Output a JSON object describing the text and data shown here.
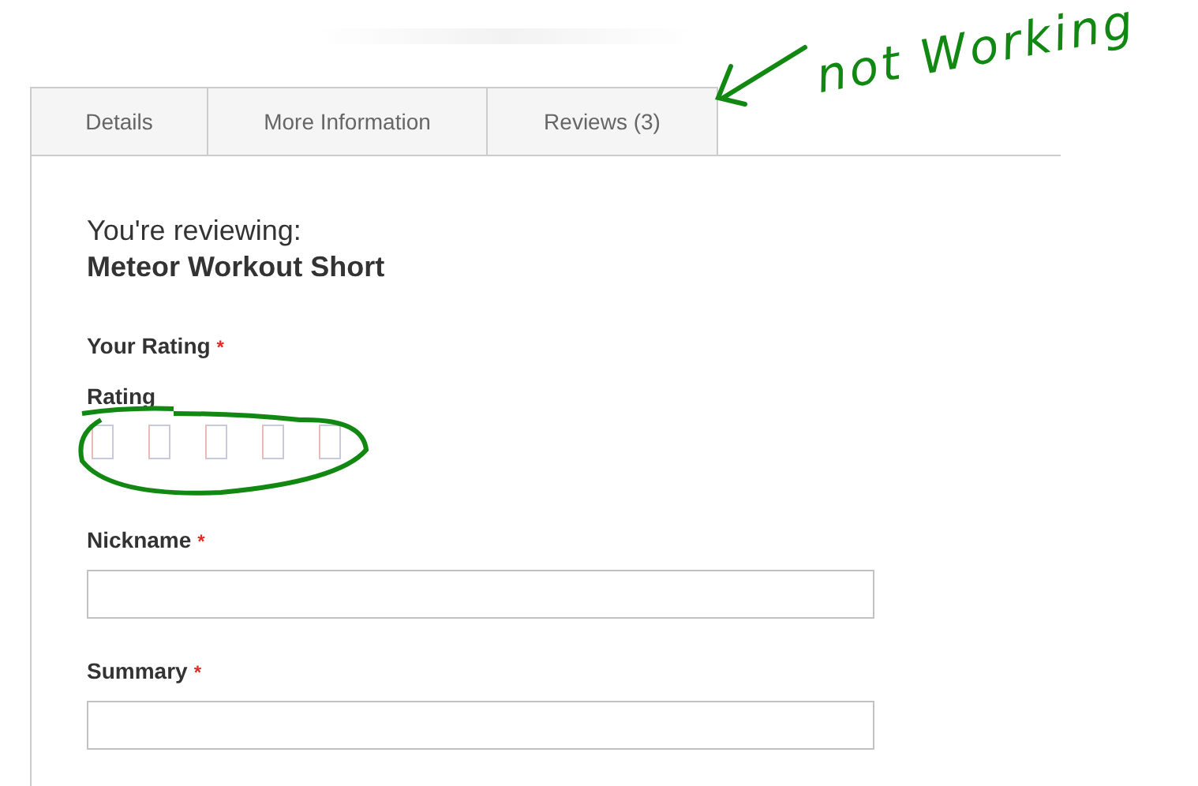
{
  "tabs": [
    {
      "label": "Details",
      "selected": false
    },
    {
      "label": "More Information",
      "selected": false
    },
    {
      "label": "Reviews (3)",
      "selected": false
    }
  ],
  "review": {
    "intro": "You're reviewing:",
    "product": "Meteor Workout Short"
  },
  "rating": {
    "label": "Your Rating",
    "required": "*",
    "sublabel": "Rating",
    "stars": 0
  },
  "fields": [
    {
      "label": "Nickname",
      "required": "*"
    },
    {
      "label": "Summary",
      "required": "*"
    }
  ],
  "annotation": {
    "text": "not Working"
  }
}
